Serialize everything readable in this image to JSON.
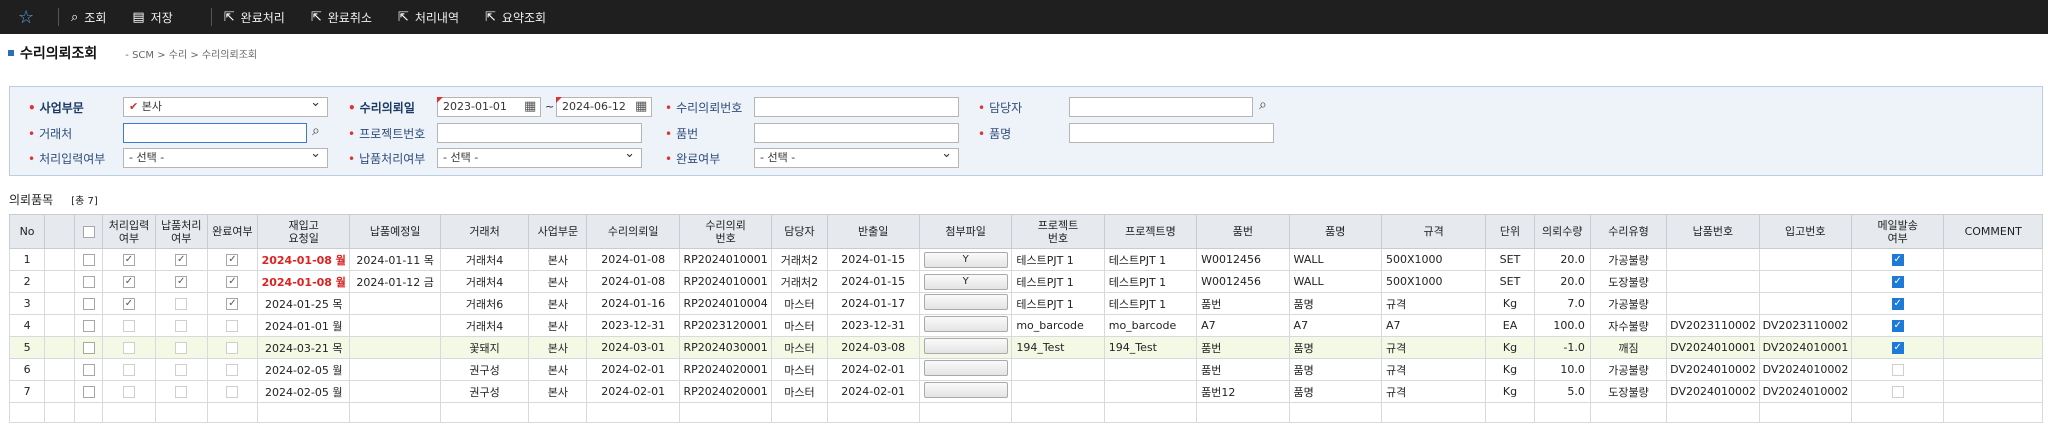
{
  "toolbar": {
    "buttons": [
      {
        "icon": "search-icon",
        "label": "조회"
      },
      {
        "icon": "document-icon",
        "label": "저장"
      },
      {
        "icon": "external-link-icon",
        "label": "완료처리"
      },
      {
        "icon": "external-link-icon",
        "label": "완료취소"
      },
      {
        "icon": "external-link-icon",
        "label": "처리내역"
      },
      {
        "icon": "external-link-icon",
        "label": "요약조회"
      }
    ]
  },
  "page": {
    "title": "수리의뢰조회",
    "breadcrumb": "- SCM > 수리 > 수리의뢰조회"
  },
  "filters": {
    "business_unit_label": "사업부문",
    "business_unit_value": "본사",
    "request_date_label": "수리의뢰일",
    "date_from": "2023-01-01",
    "date_to": "2024-06-12",
    "date_sep": "~",
    "request_no_label": "수리의뢰번호",
    "manager_label": "담당자",
    "vendor_label": "거래처",
    "project_no_label": "프로젝트번호",
    "part_no_label": "품번",
    "part_name_label": "품명",
    "process_input_label": "처리입력여부",
    "process_input_value": "- 선택 -",
    "delivery_label": "납품처리여부",
    "delivery_value": "- 선택 -",
    "complete_label": "완료여부",
    "complete_value": "- 선택 -"
  },
  "grid": {
    "title": "의뢰품목",
    "count_text": "[총 7]",
    "headers": [
      "No",
      "",
      "",
      "처리입력\n여부",
      "납품처리\n여부",
      "완료여부",
      "재입고\n요청일",
      "납품예정일",
      "거래처",
      "사업부문",
      "수리의뢰일",
      "수리의뢰\n번호",
      "담당자",
      "반출일",
      "첨부파일",
      "프로젝트\n번호",
      "프로젝트명",
      "품번",
      "품명",
      "규격",
      "단위",
      "의뢰수량",
      "수리유형",
      "납품번호",
      "입고번호",
      "메일발송\n여부",
      "COMMENT"
    ],
    "rows": [
      {
        "no": "1",
        "proc": true,
        "deliv": true,
        "done": true,
        "req_date": "2024-01-08 월",
        "req_red": true,
        "plan_date": "2024-01-11 목",
        "vendor": "거래처4",
        "bu": "본사",
        "req_day": "2024-01-08",
        "req_no": "RP2024010001",
        "mgr": "거래처2",
        "out_date": "2024-01-15",
        "file": "Y",
        "proj_no": "테스트PJT 1",
        "proj_name": "테스트PJT 1",
        "part_no": "W0012456",
        "part_name": "WALL",
        "spec": "500X1000",
        "unit": "SET",
        "qty": "20.0",
        "type": "가공불량",
        "deliv_no": "",
        "recv_no": "",
        "mail": true,
        "comment": "",
        "hl": false
      },
      {
        "no": "2",
        "proc": true,
        "deliv": true,
        "done": true,
        "req_date": "2024-01-08 월",
        "req_red": true,
        "plan_date": "2024-01-12 금",
        "vendor": "거래처4",
        "bu": "본사",
        "req_day": "2024-01-08",
        "req_no": "RP2024010001",
        "mgr": "거래처2",
        "out_date": "2024-01-15",
        "file": "Y",
        "proj_no": "테스트PJT 1",
        "proj_name": "테스트PJT 1",
        "part_no": "W0012456",
        "part_name": "WALL",
        "spec": "500X1000",
        "unit": "SET",
        "qty": "20.0",
        "type": "도장불량",
        "deliv_no": "",
        "recv_no": "",
        "mail": true,
        "comment": "",
        "hl": false
      },
      {
        "no": "3",
        "proc": true,
        "deliv": false,
        "done": true,
        "req_date": "2024-01-25 목",
        "req_red": false,
        "plan_date": "",
        "vendor": "거래처6",
        "bu": "본사",
        "req_day": "2024-01-16",
        "req_no": "RP2024010004",
        "mgr": "마스터",
        "out_date": "2024-01-17",
        "file": "",
        "proj_no": "테스트PJT 1",
        "proj_name": "테스트PJT 1",
        "part_no": "품번",
        "part_name": "품명",
        "spec": "규격",
        "unit": "Kg",
        "qty": "7.0",
        "type": "가공불량",
        "deliv_no": "",
        "recv_no": "",
        "mail": true,
        "comment": "",
        "hl": false
      },
      {
        "no": "4",
        "proc": false,
        "deliv": false,
        "done": false,
        "req_date": "2024-01-01 월",
        "req_red": false,
        "plan_date": "",
        "vendor": "거래처4",
        "bu": "본사",
        "req_day": "2023-12-31",
        "req_no": "RP2023120001",
        "mgr": "마스터",
        "out_date": "2023-12-31",
        "file": "",
        "proj_no": "mo_barcode",
        "proj_name": "mo_barcode",
        "part_no": "A7",
        "part_name": "A7",
        "spec": "A7",
        "unit": "EA",
        "qty": "100.0",
        "type": "자수불량",
        "deliv_no": "DV2023110002",
        "recv_no": "DV2023110002",
        "mail": true,
        "comment": "",
        "hl": false
      },
      {
        "no": "5",
        "proc": false,
        "deliv": false,
        "done": false,
        "req_date": "2024-03-21 목",
        "req_red": false,
        "plan_date": "",
        "vendor": "꽃돼지",
        "bu": "본사",
        "req_day": "2024-03-01",
        "req_no": "RP2024030001",
        "mgr": "마스터",
        "out_date": "2024-03-08",
        "file": "",
        "proj_no": "194_Test",
        "proj_name": "194_Test",
        "part_no": "품번",
        "part_name": "품명",
        "spec": "규격",
        "unit": "Kg",
        "qty": "-1.0",
        "type": "깨짐",
        "deliv_no": "DV2024010001",
        "recv_no": "DV2024010001",
        "mail": true,
        "comment": "",
        "hl": true
      },
      {
        "no": "6",
        "proc": false,
        "deliv": false,
        "done": false,
        "req_date": "2024-02-05 월",
        "req_red": false,
        "plan_date": "",
        "vendor": "권구성",
        "bu": "본사",
        "req_day": "2024-02-01",
        "req_no": "RP2024020001",
        "mgr": "마스터",
        "out_date": "2024-02-01",
        "file": "",
        "proj_no": "",
        "proj_name": "",
        "part_no": "품번",
        "part_name": "품명",
        "spec": "규격",
        "unit": "Kg",
        "qty": "10.0",
        "type": "가공불량",
        "deliv_no": "DV2024010002",
        "recv_no": "DV2024010002",
        "mail": false,
        "comment": "",
        "hl": false
      },
      {
        "no": "7",
        "proc": false,
        "deliv": false,
        "done": false,
        "req_date": "2024-02-05 월",
        "req_red": false,
        "plan_date": "",
        "vendor": "권구성",
        "bu": "본사",
        "req_day": "2024-02-01",
        "req_no": "RP2024020001",
        "mgr": "마스터",
        "out_date": "2024-02-01",
        "file": "",
        "proj_no": "",
        "proj_name": "",
        "part_no": "품번12",
        "part_name": "품명",
        "spec": "규격",
        "unit": "Kg",
        "qty": "5.0",
        "type": "도장불량",
        "deliv_no": "DV2024010002",
        "recv_no": "DV2024010002",
        "mail": false,
        "comment": "",
        "hl": false
      }
    ]
  }
}
